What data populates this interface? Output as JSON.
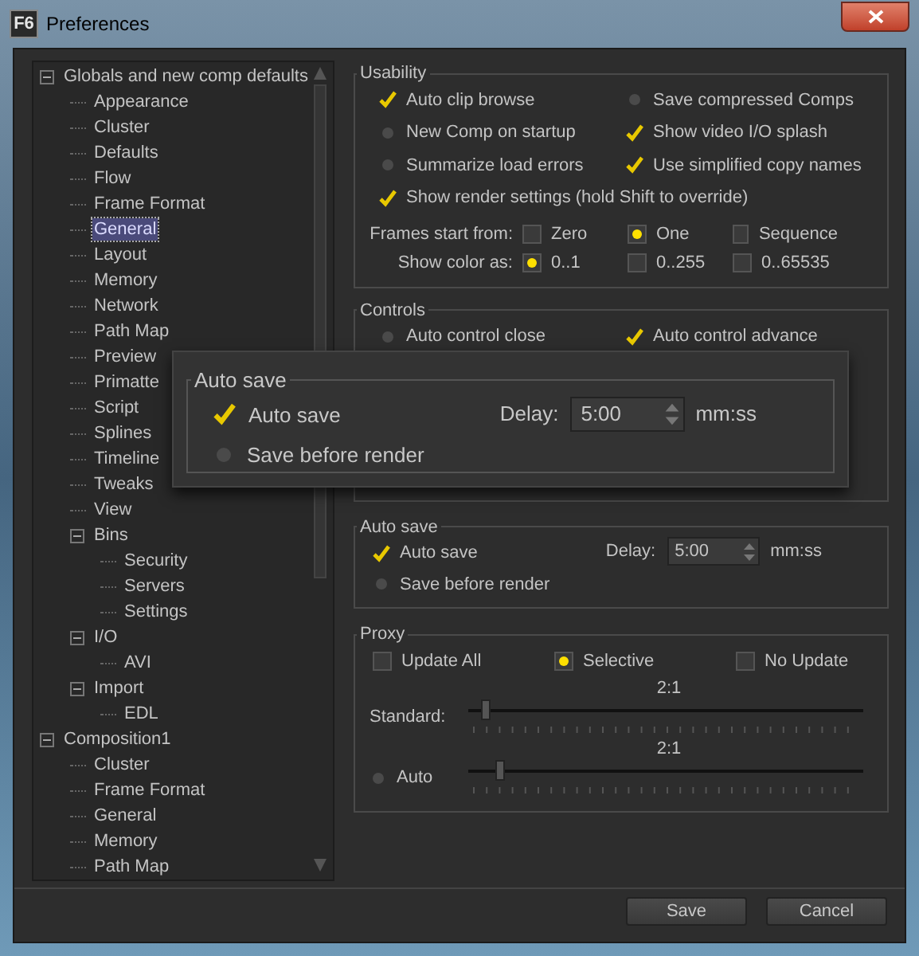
{
  "window": {
    "app_icon": "F6",
    "title": "Preferences"
  },
  "tree": [
    {
      "label": "Globals and new comp defaults",
      "selected": false,
      "expanded": true,
      "children": [
        {
          "label": "Appearance",
          "selected": false
        },
        {
          "label": "Cluster",
          "selected": false
        },
        {
          "label": "Defaults",
          "selected": false
        },
        {
          "label": "Flow",
          "selected": false
        },
        {
          "label": "Frame Format",
          "selected": false
        },
        {
          "label": "General",
          "selected": true
        },
        {
          "label": "Layout",
          "selected": false
        },
        {
          "label": "Memory",
          "selected": false
        },
        {
          "label": "Network",
          "selected": false
        },
        {
          "label": "Path Map",
          "selected": false
        },
        {
          "label": "Preview",
          "selected": false
        },
        {
          "label": "Primatte",
          "selected": false
        },
        {
          "label": "Script",
          "selected": false
        },
        {
          "label": "Splines",
          "selected": false
        },
        {
          "label": "Timeline",
          "selected": false
        },
        {
          "label": "Tweaks",
          "selected": false
        },
        {
          "label": "View",
          "selected": false
        },
        {
          "label": "Bins",
          "selected": false,
          "expanded": true,
          "children": [
            {
              "label": "Security",
              "selected": false
            },
            {
              "label": "Servers",
              "selected": false
            },
            {
              "label": "Settings",
              "selected": false
            }
          ]
        },
        {
          "label": "I/O",
          "selected": false,
          "expanded": true,
          "children": [
            {
              "label": "AVI",
              "selected": false
            }
          ]
        },
        {
          "label": "Import",
          "selected": false,
          "expanded": true,
          "children": [
            {
              "label": "EDL",
              "selected": false
            }
          ]
        }
      ]
    },
    {
      "label": "Composition1",
      "selected": false,
      "expanded": true,
      "children": [
        {
          "label": "Cluster",
          "selected": false
        },
        {
          "label": "Frame Format",
          "selected": false
        },
        {
          "label": "General",
          "selected": false
        },
        {
          "label": "Memory",
          "selected": false
        },
        {
          "label": "Path Map",
          "selected": false
        }
      ]
    }
  ],
  "usability": {
    "title": "Usability",
    "options": [
      {
        "label": "Auto clip browse",
        "checked": true
      },
      {
        "label": "Save compressed Comps",
        "checked": false
      },
      {
        "label": "New Comp on startup",
        "checked": false
      },
      {
        "label": "Show video I/O splash",
        "checked": true
      },
      {
        "label": "Summarize load errors",
        "checked": false
      },
      {
        "label": "Use simplified copy names",
        "checked": true
      }
    ],
    "wide_options": [
      {
        "label": "Show render settings (hold Shift to override)",
        "checked": true
      }
    ],
    "choice_rows": [
      {
        "label": "Frames start from:",
        "choices": [
          {
            "label": "Zero",
            "selected": false
          },
          {
            "label": "One",
            "selected": true
          },
          {
            "label": "Sequence",
            "selected": false
          }
        ]
      },
      {
        "label": "Show color as:",
        "choices": [
          {
            "label": "0..1",
            "selected": true
          },
          {
            "label": "0..255",
            "selected": false
          },
          {
            "label": "0..65535",
            "selected": false
          }
        ]
      }
    ]
  },
  "controls": {
    "title": "Controls",
    "options": [
      {
        "label": "Auto control close",
        "checked": false
      },
      {
        "label": "Auto control advance",
        "checked": true
      }
    ]
  },
  "auto_save": {
    "title": "Auto save",
    "options": [
      {
        "label": "Auto save",
        "checked": true
      },
      {
        "label": "Save before render",
        "checked": false
      }
    ],
    "delay_label": "Delay:",
    "delay": "5:00",
    "unit": "mm:ss"
  },
  "zoom_callout": {
    "title": "Auto save",
    "options": [
      {
        "label": "Auto save",
        "checked": true
      },
      {
        "label": "Save before render",
        "checked": false
      }
    ],
    "delay_label": "Delay:",
    "delay": "5:00",
    "unit": "mm:ss"
  },
  "proxy": {
    "title": "Proxy",
    "modes": [
      {
        "label": "Update All",
        "selected": false
      },
      {
        "label": "Selective",
        "selected": true
      },
      {
        "label": "No Update",
        "selected": false
      }
    ],
    "sliders": [
      {
        "kind": "plain",
        "label": "Standard:",
        "reading": "2:1",
        "level": 0.045
      },
      {
        "kind": "check",
        "label": "Auto",
        "checked": false,
        "reading": "2:1",
        "level": 0.08
      }
    ]
  },
  "buttons": [
    "Save",
    "Cancel"
  ]
}
